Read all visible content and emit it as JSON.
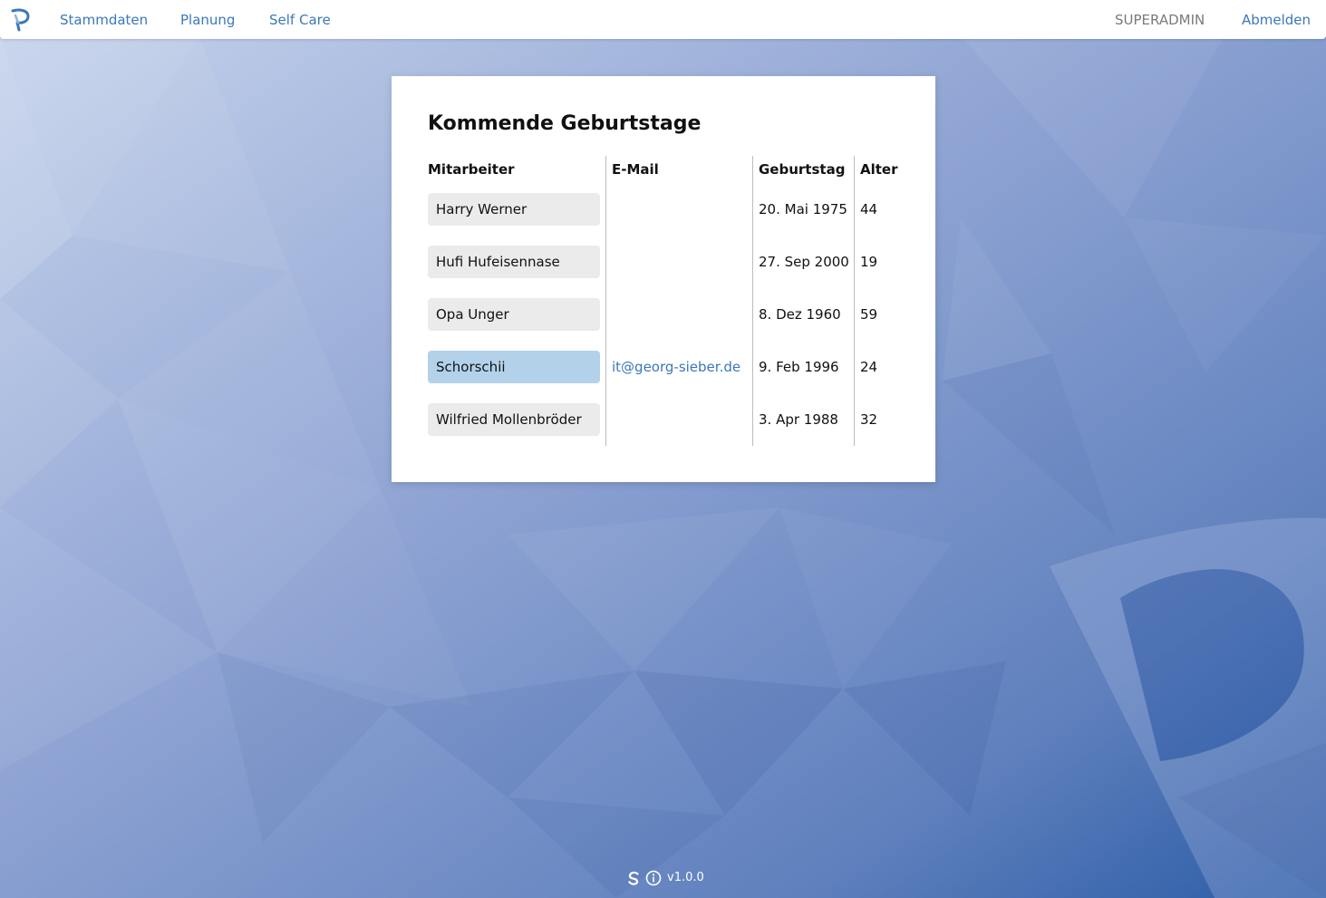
{
  "nav": {
    "links": [
      "Stammdaten",
      "Planung",
      "Self Care"
    ],
    "user": "SUPERADMIN",
    "logout": "Abmelden"
  },
  "birthdays": {
    "title": "Kommende Geburtstage",
    "columns": [
      "Mitarbeiter",
      "E-Mail",
      "Geburtstag",
      "Alter"
    ],
    "rows": [
      {
        "name": "Harry Werner",
        "email": "",
        "birthday": "20. Mai 1975",
        "age": "44",
        "active": false
      },
      {
        "name": "Hufi Hufeisennase",
        "email": "",
        "birthday": "27. Sep 2000",
        "age": "19",
        "active": false
      },
      {
        "name": "Opa Unger",
        "email": "",
        "birthday": "8. Dez 1960",
        "age": "59",
        "active": false
      },
      {
        "name": "Schorschii",
        "email": "it@georg-sieber.de",
        "birthday": "9. Feb 1996",
        "age": "24",
        "active": true
      },
      {
        "name": "Wilfried Mollenbröder",
        "email": "",
        "birthday": "3. Apr 1988",
        "age": "32",
        "active": false
      }
    ]
  },
  "footer": {
    "version": "v1.0.0"
  },
  "colors": {
    "accent": "#3b78b8",
    "active_row": "#b3d2ea",
    "pill": "#ebebeb",
    "bg_light": "#c9d6ee",
    "bg_dark": "#2c5ea8"
  },
  "icons": {
    "logo": "p-logo-icon",
    "footer_left": "s-logo-icon",
    "footer_info": "info-circle-icon"
  }
}
